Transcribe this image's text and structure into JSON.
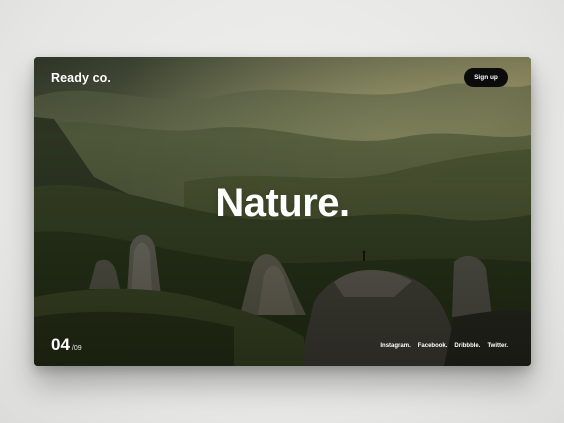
{
  "site": {
    "logo": "Ready co.",
    "signup_label": "Sign up"
  },
  "hero": {
    "title": "Nature."
  },
  "slider": {
    "current": "04",
    "total": "/09"
  },
  "social": [
    {
      "label": "Instagram."
    },
    {
      "label": "Facebook."
    },
    {
      "label": "Dribbble."
    },
    {
      "label": "Twitter."
    }
  ],
  "colors": {
    "page_background": "#e9e9e7",
    "button_background": "#0b0b0b",
    "text": "#ffffff"
  }
}
